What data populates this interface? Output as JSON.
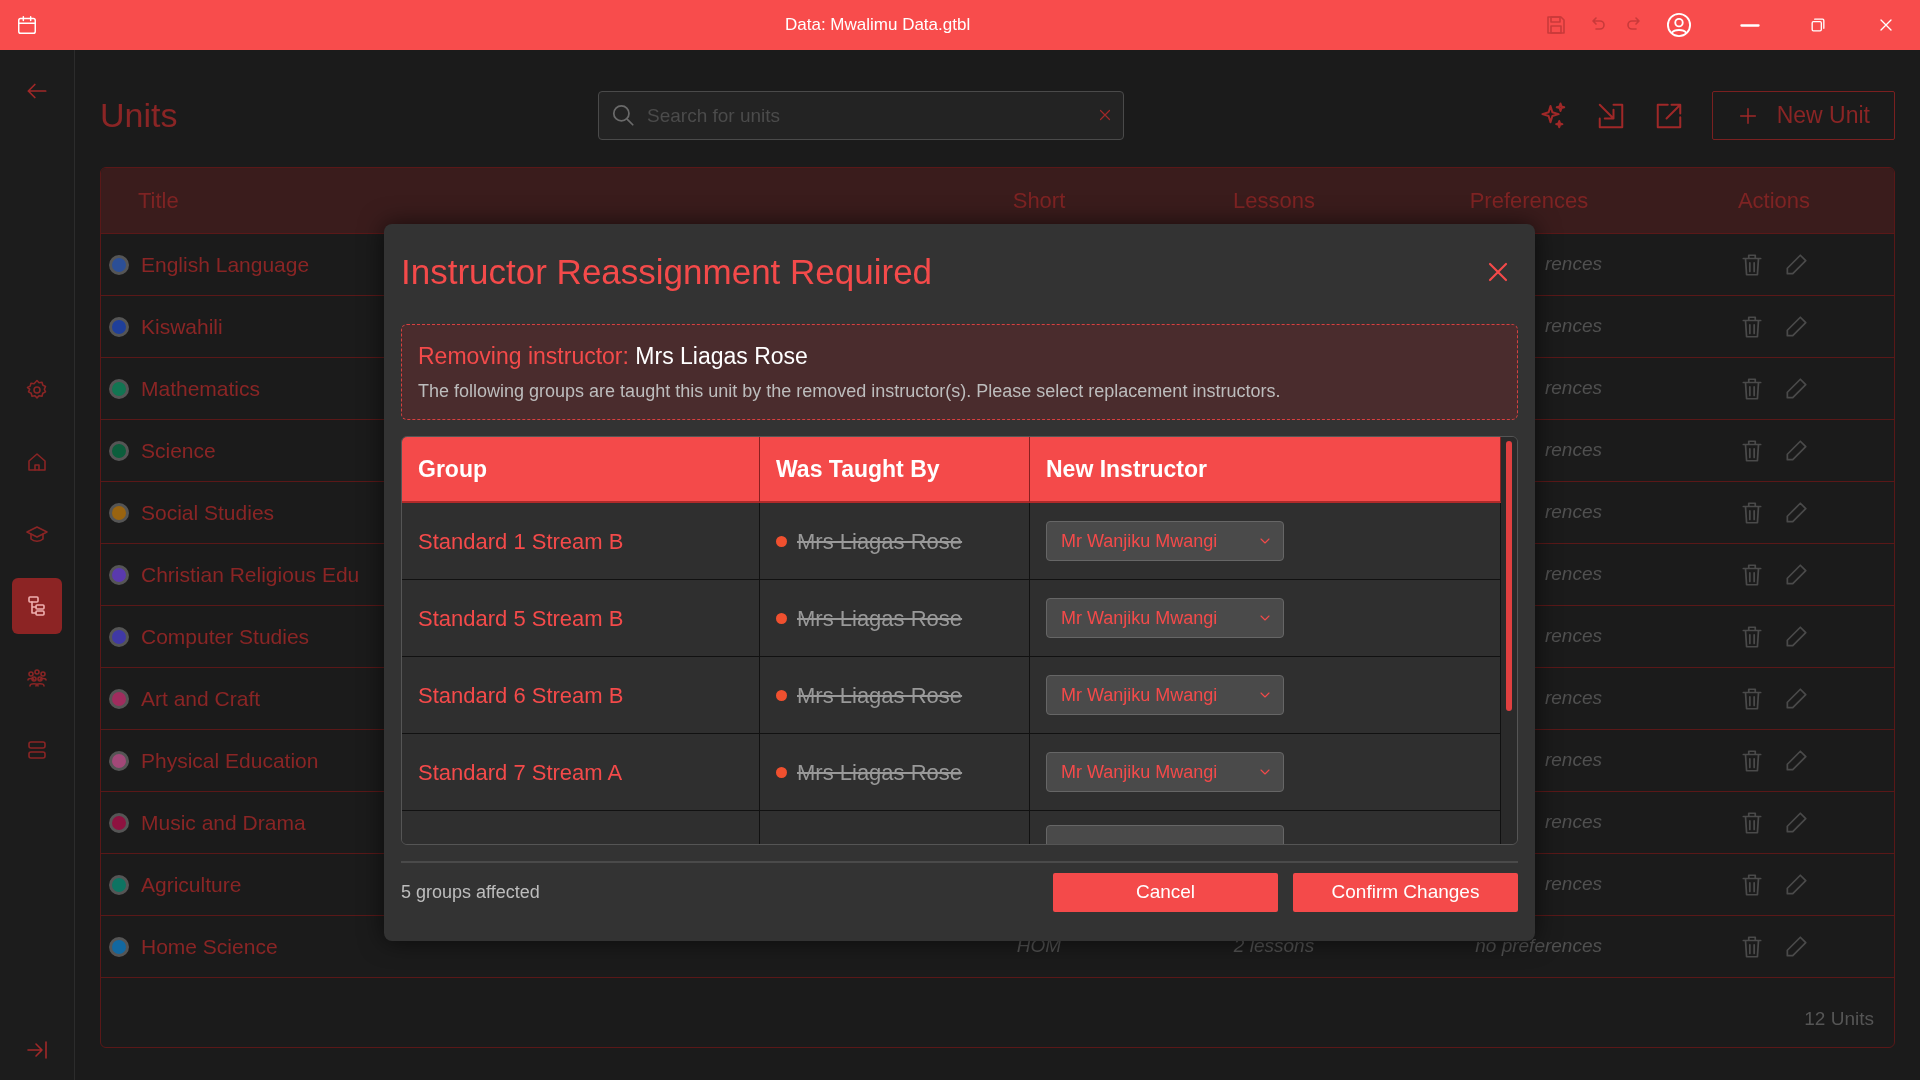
{
  "window": {
    "title": "Data: Mwalimu Data.gtbl"
  },
  "title_bar_actions": [
    {
      "disabled": true
    },
    {
      "disabled": true
    },
    {
      "disabled": true
    },
    {
      "disabled": false
    }
  ],
  "sidebar": {
    "items": [
      {
        "selected": false
      },
      {
        "selected": false
      },
      {
        "selected": false
      },
      {
        "selected": true
      },
      {
        "selected": false
      },
      {
        "selected": false
      }
    ]
  },
  "page": {
    "heading": "Units",
    "search": {
      "placeholder": "Search for units"
    },
    "new_button": "New Unit"
  },
  "table": {
    "columns": [
      "Title",
      "Short",
      "Lessons",
      "Preferences",
      "Actions"
    ],
    "rows": [
      {
        "title": "English Language",
        "color": "#2c4f96",
        "preferences": "rences"
      },
      {
        "title": "Kiswahili",
        "color": "#1f3f9a",
        "preferences": "rences"
      },
      {
        "title": "Mathematics",
        "color": "#127552",
        "preferences": "rences"
      },
      {
        "title": "Science",
        "color": "#0c5e3c",
        "preferences": "rences"
      },
      {
        "title": "Social Studies",
        "color": "#9a6410",
        "preferences": "rences"
      },
      {
        "title": "Christian Religious Edu",
        "color": "#5a3aae",
        "preferences": "rences"
      },
      {
        "title": "Computer Studies",
        "color": "#4039a6",
        "preferences": "rences"
      },
      {
        "title": "Art and Craft",
        "color": "#a02c5e",
        "preferences": "rences"
      },
      {
        "title": "Physical Education",
        "color": "#a24878",
        "preferences": "rences"
      },
      {
        "title": "Music and Drama",
        "color": "#8e1240",
        "preferences": "rences"
      },
      {
        "title": "Agriculture",
        "color": "#0e7462",
        "preferences": "rences"
      },
      {
        "title": "Home Science",
        "color": "#1268a0",
        "short": "HOM",
        "lessons": "2 lessons",
        "preferences": "no preferences"
      }
    ],
    "footer": "12 Units"
  },
  "dialog": {
    "title": "Instructor Reassignment Required",
    "notice": {
      "label": "Removing instructor:",
      "name": "Mrs Liagas Rose",
      "text": "The following groups are taught this unit by the removed instructor(s). Please select replacement instructors."
    },
    "columns": [
      "Group",
      "Was Taught By",
      "New Instructor"
    ],
    "rows": [
      {
        "group": "Standard 1 Stream B",
        "was_taught_by": "Mrs Liagas Rose",
        "new_instructor": "Mr Wanjiku Mwangi"
      },
      {
        "group": "Standard 5 Stream B",
        "was_taught_by": "Mrs Liagas Rose",
        "new_instructor": "Mr Wanjiku Mwangi"
      },
      {
        "group": "Standard 6 Stream B",
        "was_taught_by": "Mrs Liagas Rose",
        "new_instructor": "Mr Wanjiku Mwangi"
      },
      {
        "group": "Standard 7 Stream A",
        "was_taught_by": "Mrs Liagas Rose",
        "new_instructor": "Mr Wanjiku Mwangi"
      }
    ],
    "summary": "5 groups affected",
    "buttons": [
      "Cancel",
      "Confirm Changes"
    ]
  }
}
